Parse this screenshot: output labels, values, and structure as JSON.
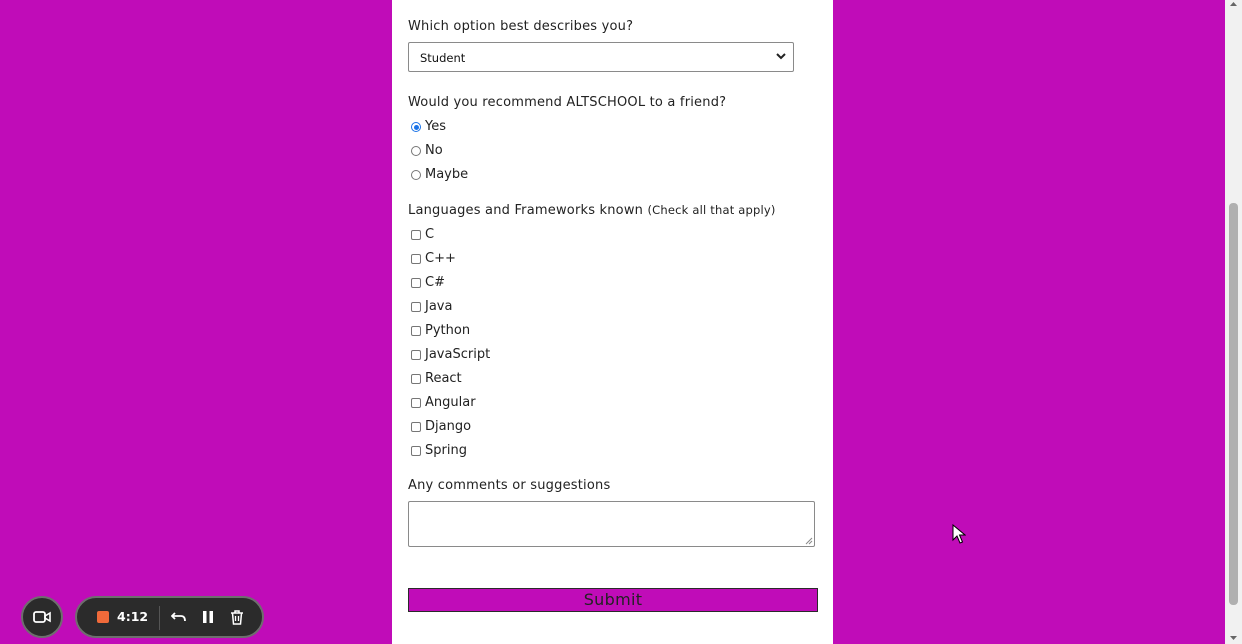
{
  "form": {
    "describe": {
      "label": "Which option best describes you?",
      "selected": "Student"
    },
    "recommend": {
      "label": "Would you recommend ALTSCHOOL to a friend?",
      "options": [
        {
          "label": "Yes",
          "checked": true
        },
        {
          "label": "No",
          "checked": false
        },
        {
          "label": "Maybe",
          "checked": false
        }
      ]
    },
    "languages": {
      "label": "Languages and Frameworks known",
      "hint": "(Check all that apply)",
      "options": [
        {
          "label": "C",
          "checked": false
        },
        {
          "label": "C++",
          "checked": false
        },
        {
          "label": "C#",
          "checked": false
        },
        {
          "label": "Java",
          "checked": false
        },
        {
          "label": "Python",
          "checked": false
        },
        {
          "label": "JavaScript",
          "checked": false
        },
        {
          "label": "React",
          "checked": false
        },
        {
          "label": "Angular",
          "checked": false
        },
        {
          "label": "Django",
          "checked": false
        },
        {
          "label": "Spring",
          "checked": false
        }
      ]
    },
    "comments": {
      "label": "Any comments or suggestions",
      "value": ""
    },
    "submit_label": "Submit"
  },
  "recorder": {
    "time": "4:12",
    "icons": [
      "camera-icon",
      "stop-icon",
      "undo-icon",
      "pause-icon",
      "trash-icon"
    ]
  },
  "colors": {
    "page_background": "#c00cb8",
    "submit_background": "#c00cb8",
    "radio_accent": "#1a73e8",
    "recorder_stop": "#f06a3a"
  }
}
